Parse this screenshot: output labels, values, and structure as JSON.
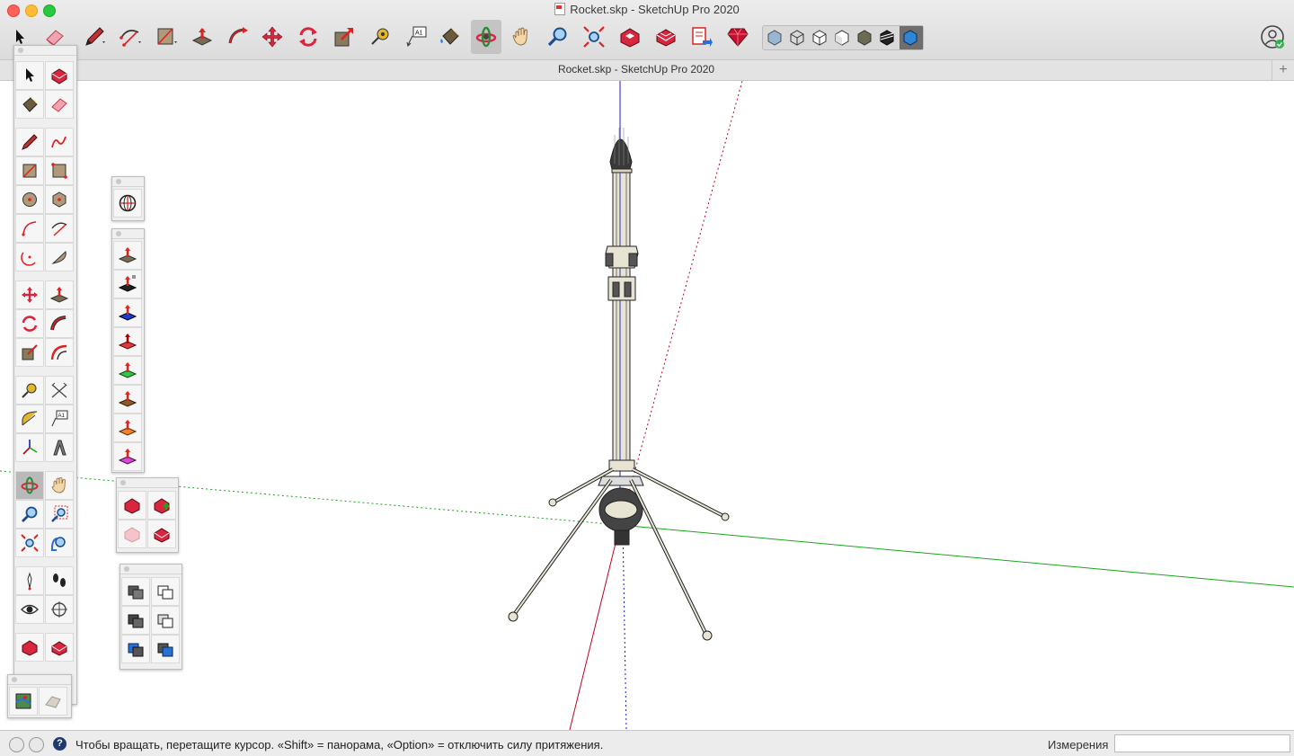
{
  "window": {
    "title": "Rocket.skp - SketchUp Pro 2020",
    "tab_title": "Rocket.skp - SketchUp Pro 2020"
  },
  "toolbar": {
    "tools": [
      "select-tool",
      "eraser-tool",
      "pencil-line-tool",
      "arc-tool",
      "rectangle-tool",
      "push-pull-tool",
      "follow-me-tool",
      "move-tool",
      "rotate-tool",
      "scale-tool",
      "tape-measure-tool",
      "text-tool",
      "paint-bucket-tool",
      "orbit-tool",
      "pan-tool",
      "zoom-tool",
      "zoom-extents-tool",
      "warehouse-tool",
      "extension-warehouse-tool",
      "layout-send-tool",
      "extension-manager-tool"
    ],
    "active_tool": "orbit-tool",
    "face_styles": [
      "xray",
      "wireframe",
      "hidden-line",
      "shaded",
      "shaded-textures",
      "monochrome",
      "solid"
    ]
  },
  "palettes": {
    "large_tool_set": {
      "active_tool": "orbit-tool"
    }
  },
  "status": {
    "hint": "Чтобы вращать, перетащите курсор. «Shift» = панорама, «Option» = отключить силу притяжения.",
    "measurements_label": "Измерения",
    "measurements_value": ""
  },
  "colors": {
    "accent_red": "#d7263d",
    "axis_red": "#c0001a",
    "axis_green": "#1aa51a",
    "axis_blue": "#1a1ad0",
    "toolbar_bg": "#e4e4e4"
  }
}
